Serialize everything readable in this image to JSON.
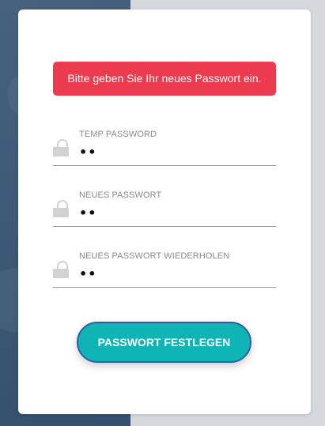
{
  "alert": {
    "text": "Bitte geben Sie Ihr neues Passwort ein."
  },
  "fields": [
    {
      "icon": "lock-icon",
      "label": "TEMP PASSWORD",
      "value": "••"
    },
    {
      "icon": "lock-icon",
      "label": "NEUES PASSWORT",
      "value": "••"
    },
    {
      "icon": "lock-icon",
      "label": "NEUES PASSWORT WIEDERHOLEN",
      "value": "••"
    }
  ],
  "submit": {
    "label": "PASSWORT FESTLEGEN"
  },
  "colors": {
    "alert_bg": "#ec3b4e",
    "button_bg": "#0fb4b5",
    "button_border": "#2a5fa5",
    "background_left": "#3e5a78",
    "background_right": "#d5d9dd"
  }
}
